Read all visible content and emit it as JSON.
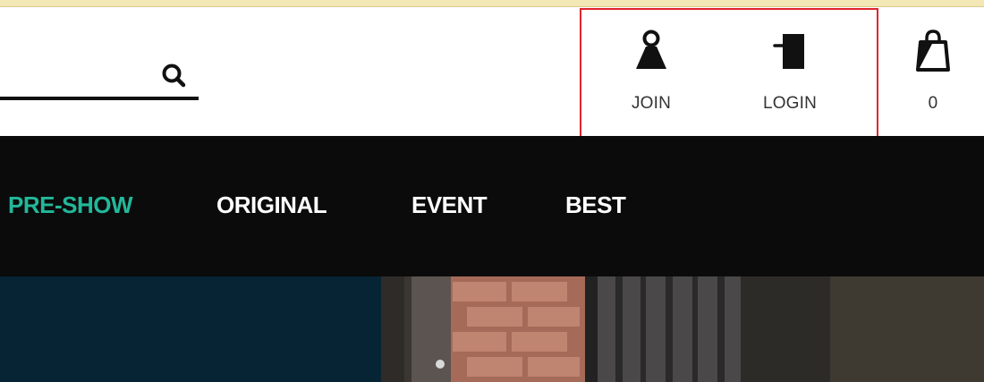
{
  "search": {
    "placeholder": "",
    "value": ""
  },
  "utility": {
    "join_label": "JOIN",
    "login_label": "LOGIN",
    "cart_count": "0"
  },
  "nav": {
    "items": [
      {
        "label": "PRE-SHOW",
        "active": true
      },
      {
        "label": "ORIGINAL",
        "active": false
      },
      {
        "label": "EVENT",
        "active": false
      },
      {
        "label": "BEST",
        "active": false
      }
    ]
  },
  "colors": {
    "nav_background": "#0b0b0b",
    "nav_active": "#22b89a",
    "highlight_outline": "#e0252c",
    "hero_dark": "#062433"
  },
  "icons": {
    "search": "search-icon",
    "join": "user-icon",
    "login": "login-icon",
    "cart": "shopping-bag-icon"
  }
}
